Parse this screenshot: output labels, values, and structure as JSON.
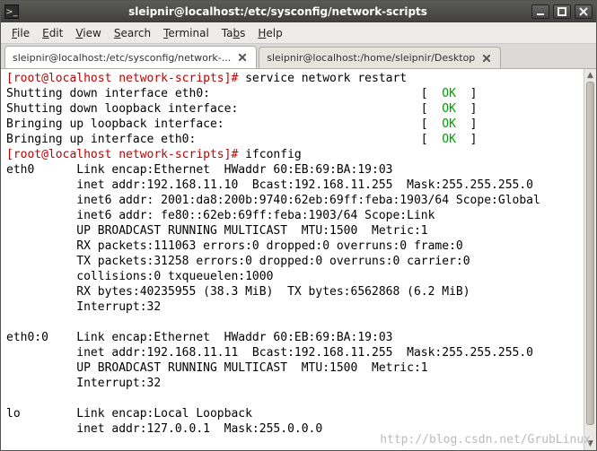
{
  "window": {
    "title": "sleipnir@localhost:/etc/sysconfig/network-scripts"
  },
  "menu": {
    "file": "File",
    "edit": "Edit",
    "view": "View",
    "search": "Search",
    "terminal": "Terminal",
    "tabs": "Tabs",
    "help": "Help"
  },
  "tabs": [
    {
      "label": "sleipnir@localhost:/etc/sysconfig/network-...",
      "active": true
    },
    {
      "label": "sleipnir@localhost:/home/sleipnir/Desktop",
      "active": false
    }
  ],
  "term": {
    "line1_prompt": "[root@localhost network-scripts]# ",
    "line1_cmd": "service network restart",
    "l2a": "Shutting down interface eth0:                              [  ",
    "l2b": "OK",
    "l2c": "  ]",
    "l3a": "Shutting down loopback interface:                          [  ",
    "l3b": "OK",
    "l3c": "  ]",
    "l4a": "Bringing up loopback interface:                            [  ",
    "l4b": "OK",
    "l4c": "  ]",
    "l5a": "Bringing up interface eth0:                                [  ",
    "l5b": "OK",
    "l5c": "  ]",
    "line6_prompt": "[root@localhost network-scripts]# ",
    "line6_cmd": "ifconfig",
    "e0_1": "eth0      Link encap:Ethernet  HWaddr 60:EB:69:BA:19:03",
    "e0_2": "          inet addr:192.168.11.10  Bcast:192.168.11.255  Mask:255.255.255.0",
    "e0_3": "          inet6 addr: 2001:da8:200b:9740:62eb:69ff:feba:1903/64 Scope:Global",
    "e0_4": "          inet6 addr: fe80::62eb:69ff:feba:1903/64 Scope:Link",
    "e0_5": "          UP BROADCAST RUNNING MULTICAST  MTU:1500  Metric:1",
    "e0_6": "          RX packets:111063 errors:0 dropped:0 overruns:0 frame:0",
    "e0_7": "          TX packets:31258 errors:0 dropped:0 overruns:0 carrier:0",
    "e0_8": "          collisions:0 txqueuelen:1000",
    "e0_9": "          RX bytes:40235955 (38.3 MiB)  TX bytes:6562868 (6.2 MiB)",
    "e0_10": "          Interrupt:32",
    "blank": "",
    "e00_1": "eth0:0    Link encap:Ethernet  HWaddr 60:EB:69:BA:19:03",
    "e00_2": "          inet addr:192.168.11.11  Bcast:192.168.11.255  Mask:255.255.255.0",
    "e00_3": "          UP BROADCAST RUNNING MULTICAST  MTU:1500  Metric:1",
    "e00_4": "          Interrupt:32",
    "lo_1": "lo        Link encap:Local Loopback",
    "lo_2": "          inet addr:127.0.0.1  Mask:255.0.0.0"
  },
  "watermark": "http://blog.csdn.net/GrubLinux"
}
